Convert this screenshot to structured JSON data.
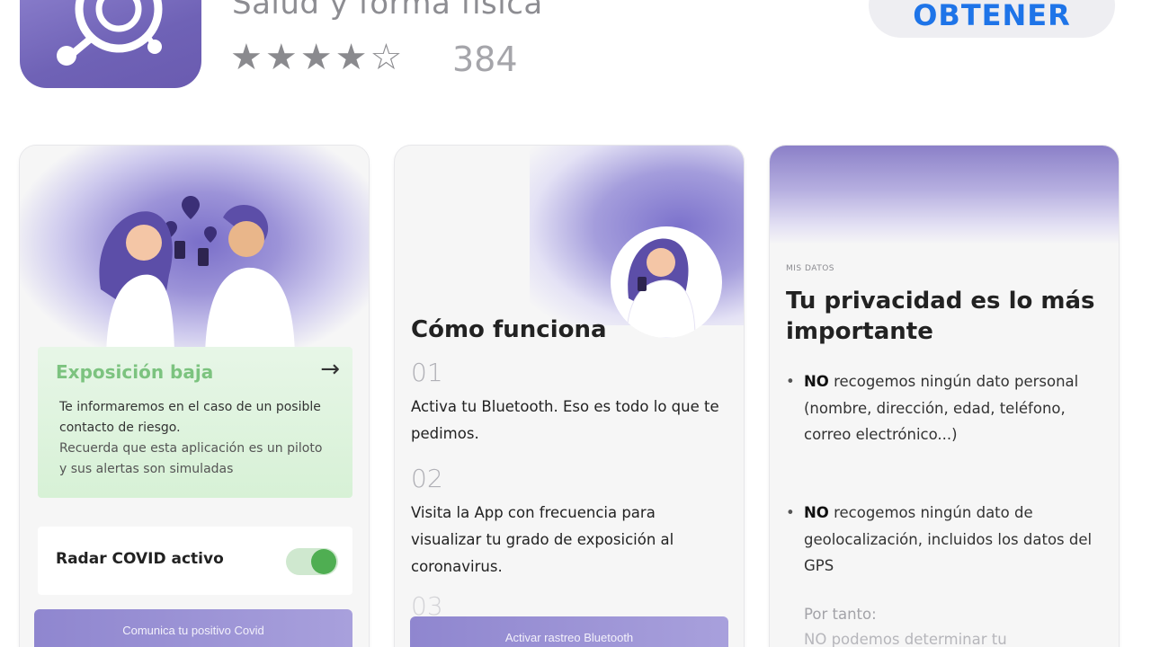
{
  "app": {
    "subtitle": "Salud y forma física",
    "rating_count": "384",
    "stars_filled": 4,
    "stars_total": 5,
    "get_label": "OBTENER",
    "icon": "app-logo-icon"
  },
  "cards": {
    "card1": {
      "exposure_title": "Exposición baja",
      "exposure_text": "Te informaremos en el caso de un posible contacto de riesgo.",
      "exposure_note": "Recuerda que esta aplicación es un piloto y sus alertas son simuladas",
      "radar_label": "Radar COVID activo",
      "radar_enabled": true,
      "button_label": "Comunica tu positivo Covid"
    },
    "card2": {
      "title": "Cómo funciona",
      "steps": [
        {
          "num": "01",
          "text": "Activa tu Bluetooth. Eso es todo lo que te pedimos."
        },
        {
          "num": "02",
          "text": "Visita la App con frecuencia para visualizar tu grado de exposición al coronavirus."
        },
        {
          "num": "03",
          "text": ""
        }
      ],
      "button_label": "Activar rastreo Bluetooth"
    },
    "card3": {
      "section_label": "MIS DATOS",
      "title": "Tu privacidad es lo más importante",
      "bullets": [
        {
          "strong": "NO",
          "text": " recogemos ningún dato personal (nombre, dirección, edad, teléfono, correo electrónico...)"
        },
        {
          "strong": "NO",
          "text": " recogemos ningún dato de geolocalización, incluidos los datos del GPS"
        }
      ],
      "por_tanto": "Por tanto:",
      "por_tanto_cont": "NO podemos determinar tu"
    }
  },
  "colors": {
    "accent": "#1e74e8",
    "brand_purple": "#6f62b6",
    "exposure_green": "#7cc37f",
    "toggle_green": "#4fae52"
  }
}
